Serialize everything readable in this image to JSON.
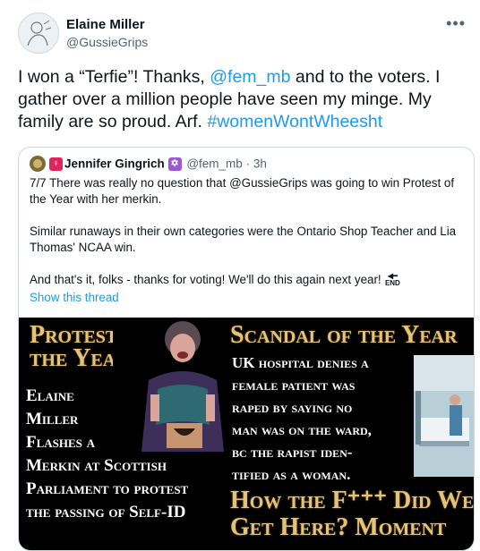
{
  "tweet": {
    "author_name": "Elaine Miller",
    "author_handle": "@GussieGrips",
    "more_icon": "more-horizontal-icon",
    "text_parts": {
      "t1": "I won a “Terfie”! Thanks, ",
      "mention": "@fem_mb",
      "t2": " and to the voters. I gather over a million people have seen my minge.  My family are so proud.  Arf.  ",
      "hashtag": "#womenWontWheesht"
    }
  },
  "quote": {
    "author_name": "Jennifer Gingrich",
    "author_handle": "@fem_mb",
    "separator": "·",
    "time": "3h",
    "venus_symbol": "♀",
    "star_symbol": "✡",
    "paragraphs": [
      "7/7 There was really no question that @GussieGrips was going to win Protest of the Year with her merkin.",
      "Similar runaways in their own categories were the Ontario Shop Teacher and Lia Thomas' NCAA win.",
      "And that's it, folks - thanks for voting! We'll do this again next year!"
    ],
    "end_icon_text": "END",
    "show_thread": "Show this thread"
  },
  "image": {
    "left_title_line1": "Protest of",
    "left_title_line2": "the Year",
    "left_caption": [
      "Elaine",
      "Miller",
      "Flashes a",
      "Merkin at Scottish",
      "Parliament to protest",
      "the passing of Self-ID"
    ],
    "right_title": "Scandal of the Year",
    "right_caption": [
      "UK hospital denies a",
      "female patient was",
      "raped by saying no",
      "man was on the ward,",
      "bc the rapist iden-",
      "tified as a woman."
    ],
    "right_bottom_line1": "How the F⁺⁺⁺ Did We",
    "right_bottom_line2": "Get Here? Moment"
  },
  "colors": {
    "link": "#1d9bf0",
    "secondary_text": "#536471",
    "gold_text": "#e4c27a",
    "image_background": "#000000"
  }
}
